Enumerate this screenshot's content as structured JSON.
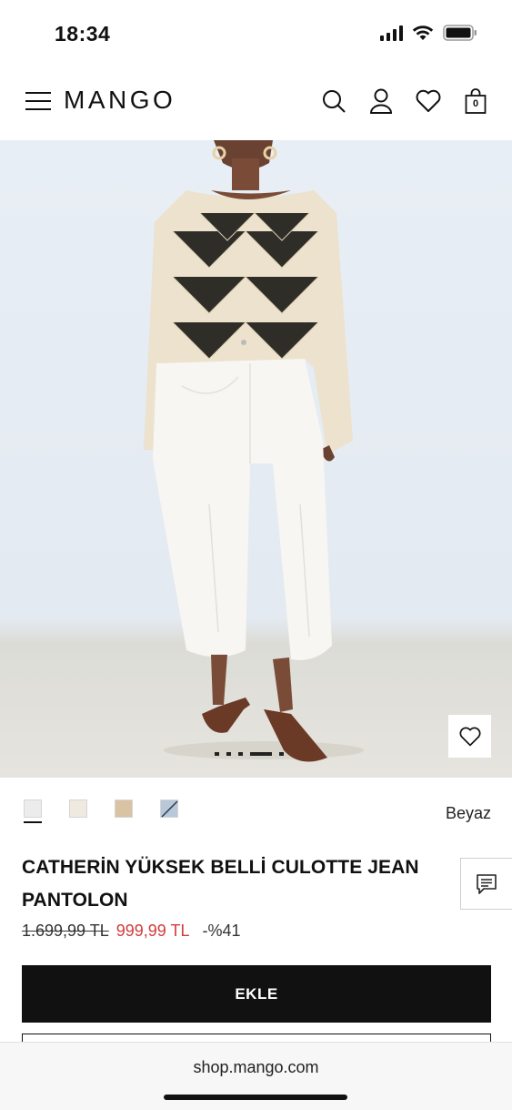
{
  "status_bar": {
    "time": "18:34"
  },
  "header": {
    "logo": "MANGO",
    "cart_count": "0"
  },
  "product": {
    "image_alt": "product-photo-model",
    "image_dots": 5,
    "active_dot": 3,
    "swatch_colors": [
      "#ececec",
      "#efe9df",
      "#d9c3a2",
      "#b8c8d8"
    ],
    "color_name": "Beyaz",
    "title": "CATHERİN YÜKSEK BELLİ CULOTTE JEAN PANTOLON",
    "old_price": "1.699,99 TL",
    "new_price": "999,99 TL",
    "discount": "-%41",
    "add_button": "EKLE"
  },
  "browser": {
    "url": "shop.mango.com"
  },
  "colors": {
    "sale": "#d13b3b",
    "primary": "#111111"
  }
}
